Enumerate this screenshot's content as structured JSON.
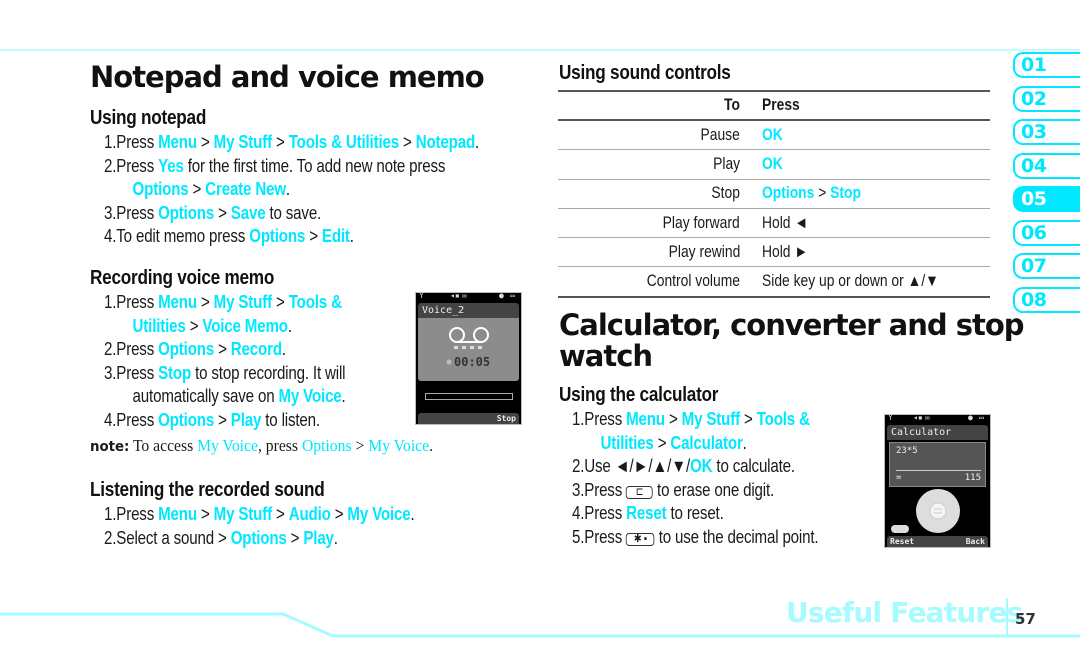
{
  "left": {
    "title": "Notepad and voice memo",
    "notepad": {
      "heading": "Using notepad",
      "steps": [
        {
          "num": "1.",
          "parts": [
            {
              "t": "Press "
            },
            {
              "t": "Menu",
              "hl": true
            },
            {
              "t": " > "
            },
            {
              "t": "My Stuff",
              "hl": true
            },
            {
              "t": " > "
            },
            {
              "t": "Tools & Utilities",
              "hl": true
            },
            {
              "t": " > "
            },
            {
              "t": "Notepad",
              "hl": true
            },
            {
              "t": "."
            }
          ]
        },
        {
          "num": "2.",
          "parts": [
            {
              "t": "Press "
            },
            {
              "t": "Yes",
              "hl": true
            },
            {
              "t": " for the first time. To add new note press"
            }
          ]
        },
        {
          "num": "",
          "indent": true,
          "parts": [
            {
              "t": "Options",
              "hl": true
            },
            {
              "t": " > "
            },
            {
              "t": "Create New",
              "hl": true
            },
            {
              "t": "."
            }
          ]
        },
        {
          "num": "3.",
          "parts": [
            {
              "t": "Press "
            },
            {
              "t": "Options",
              "hl": true
            },
            {
              "t": " > "
            },
            {
              "t": "Save",
              "hl": true
            },
            {
              "t": " to save."
            }
          ]
        },
        {
          "num": "4.",
          "parts": [
            {
              "t": "To edit memo press "
            },
            {
              "t": "Options",
              "hl": true
            },
            {
              "t": " > "
            },
            {
              "t": "Edit",
              "hl": true
            },
            {
              "t": "."
            }
          ]
        }
      ]
    },
    "recording": {
      "heading": "Recording voice memo",
      "steps": [
        {
          "num": "1.",
          "parts": [
            {
              "t": "Press "
            },
            {
              "t": "Menu",
              "hl": true
            },
            {
              "t": " > "
            },
            {
              "t": "My Stuff",
              "hl": true
            },
            {
              "t": " > "
            },
            {
              "t": "Tools &",
              "hl": true
            }
          ]
        },
        {
          "num": "",
          "indent": true,
          "parts": [
            {
              "t": "Utilities",
              "hl": true
            },
            {
              "t": " > "
            },
            {
              "t": "Voice Memo",
              "hl": true
            },
            {
              "t": "."
            }
          ]
        },
        {
          "num": "2.",
          "parts": [
            {
              "t": "Press "
            },
            {
              "t": "Options",
              "hl": true
            },
            {
              "t": " > "
            },
            {
              "t": "Record",
              "hl": true
            },
            {
              "t": "."
            }
          ]
        },
        {
          "num": "3.",
          "parts": [
            {
              "t": "Press "
            },
            {
              "t": "Stop",
              "hl": true
            },
            {
              "t": " to stop recording. It will"
            }
          ]
        },
        {
          "num": "",
          "indent": true,
          "parts": [
            {
              "t": "automatically save on "
            },
            {
              "t": "My Voice",
              "hl": true
            },
            {
              "t": "."
            }
          ]
        },
        {
          "num": "4.",
          "parts": [
            {
              "t": "Press "
            },
            {
              "t": "Options",
              "hl": true
            },
            {
              "t": " > "
            },
            {
              "t": "Play",
              "hl": true
            },
            {
              "t": " to listen."
            }
          ]
        }
      ],
      "note": {
        "label": "note:",
        "parts": [
          {
            "t": " To access "
          },
          {
            "t": "My Voice",
            "hl": true
          },
          {
            "t": ", press "
          },
          {
            "t": "Options",
            "hl": true
          },
          {
            "t": " > "
          },
          {
            "t": "My Voice",
            "hl": true
          },
          {
            "t": "."
          }
        ]
      },
      "phone": {
        "title": "Voice_2",
        "time": "00:05",
        "softkey_right": "Stop"
      }
    },
    "listening": {
      "heading": "Listening the recorded sound",
      "steps": [
        {
          "num": "1.",
          "parts": [
            {
              "t": "Press "
            },
            {
              "t": "Menu",
              "hl": true
            },
            {
              "t": " > "
            },
            {
              "t": "My Stuff",
              "hl": true
            },
            {
              "t": " > "
            },
            {
              "t": "Audio",
              "hl": true
            },
            {
              "t": " > "
            },
            {
              "t": "My Voice",
              "hl": true
            },
            {
              "t": "."
            }
          ]
        },
        {
          "num": "2.",
          "parts": [
            {
              "t": "Select a sound > "
            },
            {
              "t": "Options",
              "hl": true
            },
            {
              "t": " > "
            },
            {
              "t": "Play",
              "hl": true
            },
            {
              "t": "."
            }
          ]
        }
      ]
    }
  },
  "right": {
    "sound_controls": {
      "heading": "Using sound controls",
      "columns": [
        "To",
        "Press"
      ],
      "rows": [
        {
          "to": "Pause",
          "press": [
            {
              "t": "OK",
              "hl": true
            }
          ]
        },
        {
          "to": "Play",
          "press": [
            {
              "t": "OK",
              "hl": true
            }
          ]
        },
        {
          "to": "Stop",
          "press": [
            {
              "t": "Options",
              "hl": true
            },
            {
              "t": " > "
            },
            {
              "t": "Stop",
              "hl": true
            }
          ]
        },
        {
          "to": "Play forward",
          "press": [
            {
              "t": "Hold ◄"
            }
          ]
        },
        {
          "to": "Play rewind",
          "press": [
            {
              "t": "Hold ►"
            }
          ]
        },
        {
          "to": "Control volume",
          "press": [
            {
              "t": "Side key up or down or ▲/▼"
            }
          ]
        }
      ]
    },
    "title": "Calculator, converter and stop watch",
    "title_line1": "Calculator, converter and stop",
    "title_line2": "watch",
    "calculator": {
      "heading": "Using the calculator",
      "steps": [
        {
          "num": "1.",
          "parts": [
            {
              "t": "Press "
            },
            {
              "t": "Menu",
              "hl": true
            },
            {
              "t": " > "
            },
            {
              "t": "My Stuff",
              "hl": true
            },
            {
              "t": " > "
            },
            {
              "t": "Tools &",
              "hl": true
            }
          ]
        },
        {
          "num": "",
          "indent": true,
          "parts": [
            {
              "t": "Utilities",
              "hl": true
            },
            {
              "t": " > "
            },
            {
              "t": "Calculator",
              "hl": true
            },
            {
              "t": "."
            }
          ]
        },
        {
          "num": "2.",
          "parts": [
            {
              "t": "Use ◄/►/▲/▼/"
            },
            {
              "t": "OK",
              "hl": true
            },
            {
              "t": " to calculate."
            }
          ]
        },
        {
          "num": "3.",
          "parts": [
            {
              "t": "Press "
            },
            {
              "key": "c-key",
              "t": "⊏"
            },
            {
              "t": " to erase one digit."
            }
          ]
        },
        {
          "num": "4.",
          "parts": [
            {
              "t": "Press "
            },
            {
              "t": "Reset",
              "hl": true
            },
            {
              "t": " to reset."
            }
          ]
        },
        {
          "num": "5.",
          "parts": [
            {
              "t": "Press "
            },
            {
              "key": "star-key",
              "t": "✱ ▪"
            },
            {
              "t": " to use the decimal point."
            }
          ]
        }
      ],
      "phone": {
        "title": "Calculator",
        "expression": "23*5",
        "equals": "=",
        "result": "115",
        "softkey_left": "Reset",
        "softkey_right": "Back"
      }
    }
  },
  "side_tabs": [
    {
      "label": "01",
      "active": false
    },
    {
      "label": "02",
      "active": false
    },
    {
      "label": "03",
      "active": false
    },
    {
      "label": "04",
      "active": false
    },
    {
      "label": "05",
      "active": true
    },
    {
      "label": "06",
      "active": false
    },
    {
      "label": "07",
      "active": false
    },
    {
      "label": "08",
      "active": false
    }
  ],
  "footer": {
    "section": "Useful Features",
    "page": "57"
  },
  "colors": {
    "accent": "#00e8ff",
    "accent_light": "#a6fbff",
    "rule": "#c4fbfb"
  }
}
